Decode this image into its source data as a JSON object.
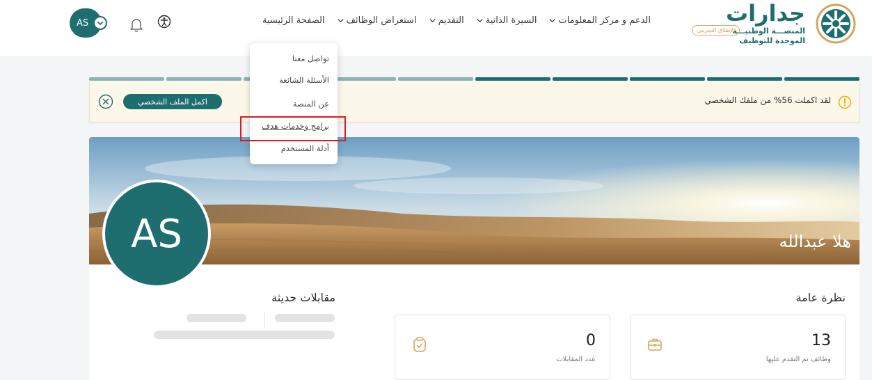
{
  "header": {
    "logo": {
      "title": "جدارات",
      "subtitle_line1": "المنصـــة الوطنيـــة",
      "subtitle_line2": "الموحدة للتوظيف",
      "badge": "الإطلاق التجريبي"
    },
    "nav": [
      {
        "label": "الصفحة الرئيسية",
        "has_dropdown": false
      },
      {
        "label": "استعراض الوظائف",
        "has_dropdown": true
      },
      {
        "label": "التقديم",
        "has_dropdown": true
      },
      {
        "label": "السيرة الذاتية",
        "has_dropdown": true
      },
      {
        "label": "الدعم و مركز المعلومات",
        "has_dropdown": true
      }
    ],
    "user_initials": "AS"
  },
  "dropdown": {
    "items": [
      "تواصل معنا",
      "الأسئلة الشائعة",
      "عن المنصة",
      "برامج وخدمات هدف",
      "أدلة المستخدم"
    ],
    "highlighted_index": 3
  },
  "profile_progress": {
    "segments_total": 10,
    "segments_complete": 5,
    "percent": 56,
    "colors": {
      "complete": "#1e6e70",
      "incomplete": "#8fb3b0"
    }
  },
  "alert": {
    "text": "لقد اكملت 56% من ملفك الشخصي",
    "button_label": "اكمل الملف الشخصي"
  },
  "profile": {
    "name": "هلا عبدالله",
    "initials": "AS"
  },
  "overview": {
    "title": "نظرة عامة",
    "stats": [
      {
        "value": "13",
        "label": "وظائف تم التقدم عليها",
        "icon": "briefcase-icon"
      },
      {
        "value": "0",
        "label": "عدد المقابلات",
        "icon": "clipboard-check-icon"
      }
    ]
  },
  "recent_interviews": {
    "title": "مقابلات حديثة"
  },
  "colors": {
    "brand": "#1e6e70",
    "accent": "#d8a35c",
    "alert_bg": "#fbf7e9",
    "highlight_box": "#e0191f"
  }
}
